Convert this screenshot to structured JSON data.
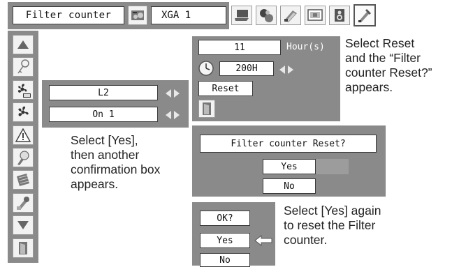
{
  "menubar": {
    "title": "Filter counter",
    "input_label": "XGA 1",
    "icons": [
      "image-adjust-icon",
      "computer-icon",
      "image-select-icon",
      "image-color-icon",
      "screen-icon",
      "sound-icon",
      "setting-icon"
    ]
  },
  "sidebar": {
    "icons": [
      "scroll-up-icon",
      "key-icon",
      "fan-default-icon",
      "fan-icon",
      "warning-icon",
      "lamp-icon",
      "filter-icon",
      "wrench-icon",
      "scroll-down-icon",
      "exit-icon"
    ]
  },
  "settings": {
    "fan_value": "L2",
    "mode_value": "On 1"
  },
  "counter": {
    "hours_value": "11",
    "hours_unit": "Hour(s)",
    "timer_value": "200H",
    "reset_label": "Reset"
  },
  "confirm1": {
    "question": "Filter counter Reset?",
    "yes": "Yes",
    "no": "No"
  },
  "confirm2": {
    "question": "OK?",
    "yes": "Yes",
    "no": "No"
  },
  "notes": {
    "reset_line1": "Select Reset",
    "reset_line2": "and the “Filter",
    "reset_line3": "counter Reset?”",
    "reset_line4": "appears.",
    "yes_line1": "Select [Yes],",
    "yes_line2": "then another",
    "yes_line3": "confirmation box",
    "yes_line4": "appears.",
    "again_line1": "Select [Yes] again",
    "again_line2": "to reset the Filter",
    "again_line3": "counter."
  },
  "colors": {
    "panel": "#8a8a8a",
    "highlight": "#9c9c9c"
  }
}
